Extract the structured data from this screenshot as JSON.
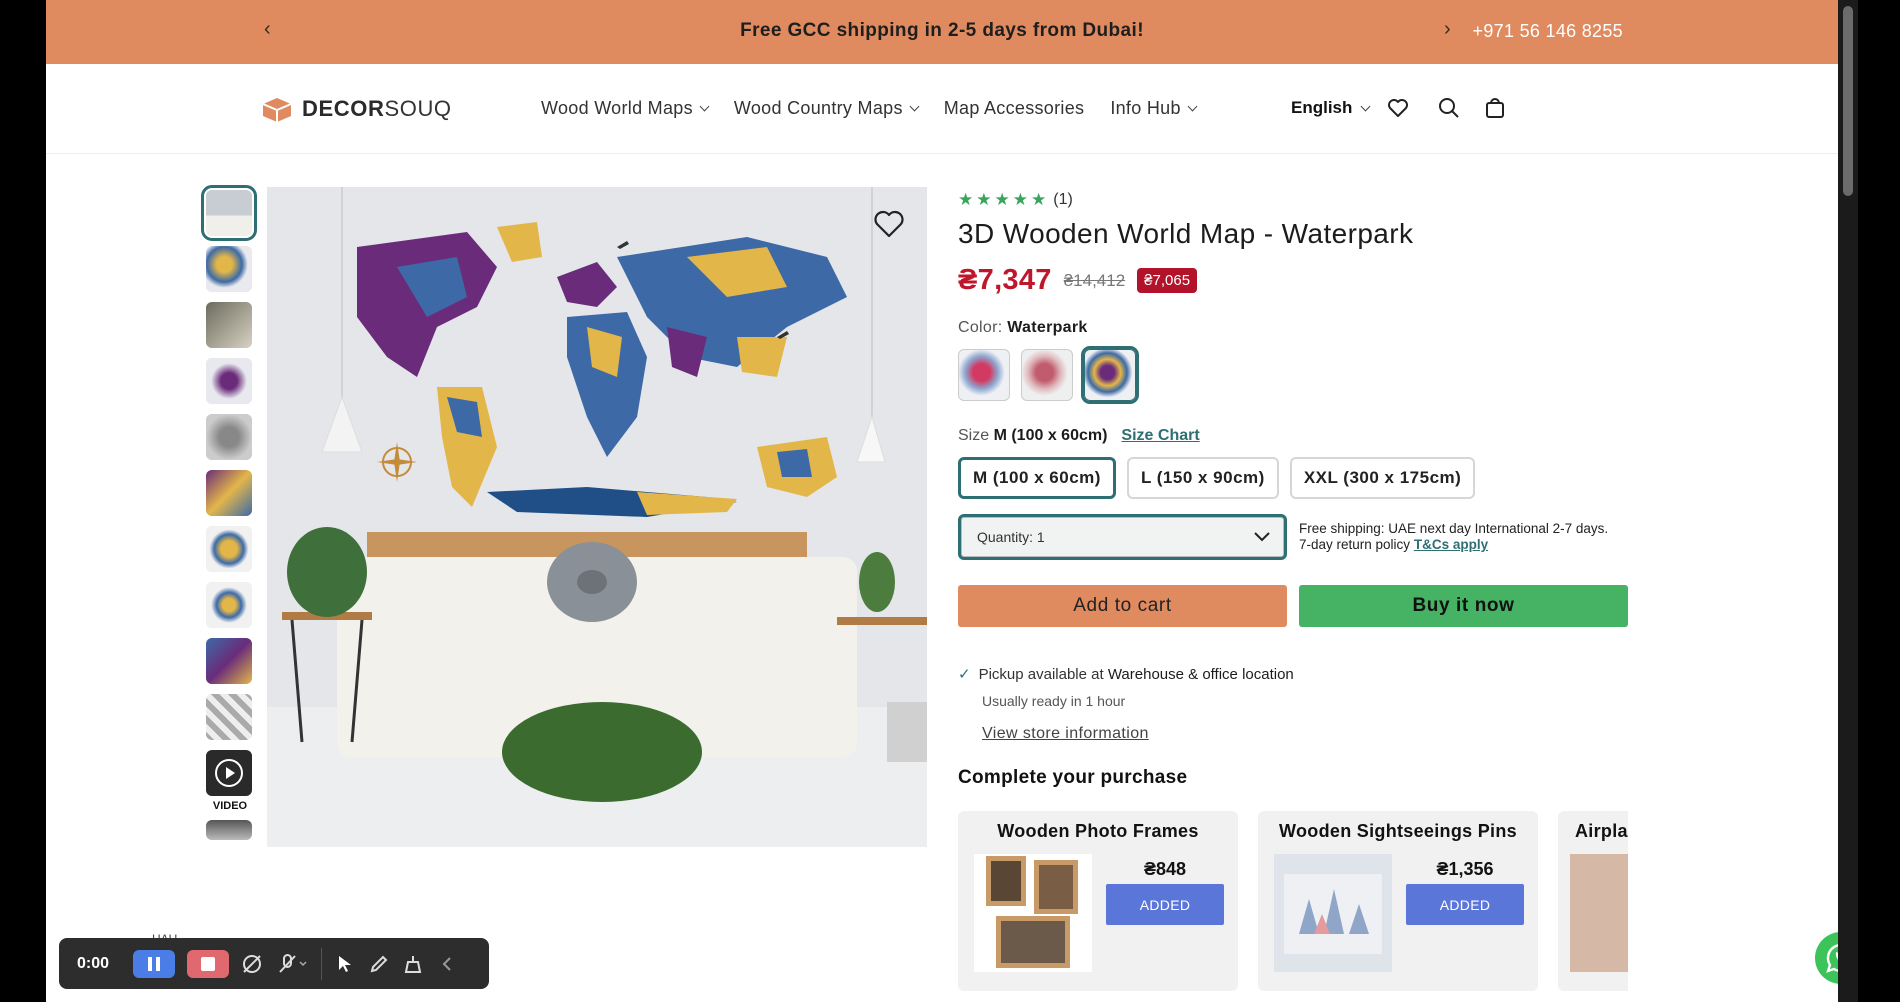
{
  "announcement": {
    "message": "Free GCC shipping in 2-5 days from Dubai!",
    "phone": "+971 56 146 8255"
  },
  "header": {
    "logo_bold": "DECOR",
    "logo_light": "SOUQ",
    "nav": [
      "Wood World Maps",
      "Wood Country Maps",
      "Map Accessories",
      "Info Hub"
    ],
    "language": "English"
  },
  "gallery": {
    "video_label": "VIDEO"
  },
  "product": {
    "rating_count": "(1)",
    "title": "3D Wooden World Map - Waterpark",
    "price": "₴7,347",
    "compare_price": "₴14,412",
    "save_badge": "₴7,065",
    "color_label": "Color:",
    "color_value": "Waterpark",
    "size_label": "Size",
    "size_value": "M (100 x 60cm)",
    "size_chart": "Size Chart",
    "sizes": [
      "M (100 x 60cm)",
      "L (150 x 90cm)",
      "XXL (300 x 175cm)"
    ],
    "quantity": "Quantity: 1",
    "shipping_note_1": "Free shipping: UAE next day International 2-7 days.",
    "shipping_note_2": "7-day return policy",
    "tcs_link": "T&Cs apply",
    "add_to_cart": "Add to cart",
    "buy_now": "Buy it now",
    "pickup_text": "Pickup available at",
    "pickup_location": "Warehouse & office location",
    "ready_text": "Usually ready in 1 hour",
    "store_info": "View store information",
    "complete_heading": "Complete your purchase"
  },
  "recommendations": [
    {
      "name": "Wooden Photo Frames",
      "price": "₴848",
      "button": "ADDED"
    },
    {
      "name": "Wooden Sightseeings Pins",
      "price": "₴1,356",
      "button": "ADDED"
    },
    {
      "name": "Airpla",
      "price": "",
      "button": ""
    }
  ],
  "recorder": {
    "time": "0:00"
  },
  "overlay_text": "HAU",
  "colors": {
    "announcement_bg": "#e08a5f",
    "accent_teal": "#2e6f73",
    "sale_red": "#c0162c",
    "buy_green": "#45b264",
    "added_blue": "#5b76d9"
  }
}
